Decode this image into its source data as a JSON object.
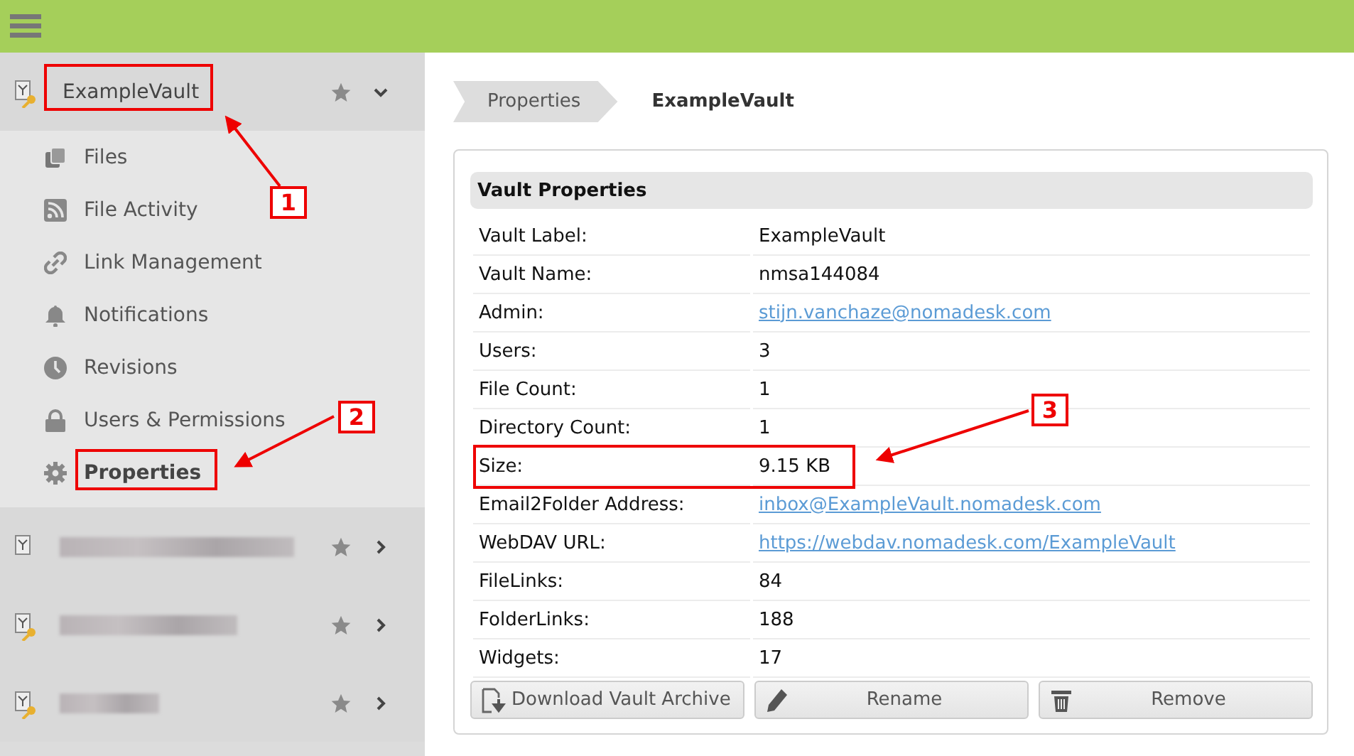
{
  "sidebar": {
    "vault": {
      "name": "ExampleVault",
      "expanded": true,
      "keyed": true
    },
    "items": [
      {
        "label": "Files",
        "kind": "files",
        "selected": false
      },
      {
        "label": "File Activity",
        "kind": "rss",
        "selected": false
      },
      {
        "label": "Link Management",
        "kind": "link",
        "selected": false
      },
      {
        "label": "Notifications",
        "kind": "bell",
        "selected": false
      },
      {
        "label": "Revisions",
        "kind": "clock",
        "selected": false
      },
      {
        "label": "Users & Permissions",
        "kind": "lock",
        "selected": false
      },
      {
        "label": "Properties",
        "kind": "gear",
        "selected": true
      }
    ],
    "other_vaults": [
      {
        "keyed": false,
        "expanded": false
      },
      {
        "keyed": true,
        "expanded": false
      },
      {
        "keyed": true,
        "expanded": false
      }
    ]
  },
  "breadcrumb": [
    {
      "label": "Properties"
    },
    {
      "label": "ExampleVault"
    }
  ],
  "panel": {
    "title": "Vault Properties",
    "rows": [
      {
        "label": "Vault Label:",
        "value": "ExampleVault",
        "kind": "text"
      },
      {
        "label": "Vault Name:",
        "value": "nmsa144084",
        "kind": "text"
      },
      {
        "label": "Admin:",
        "value": "stijn.vanchaze@nomadesk.com",
        "kind": "link"
      },
      {
        "label": "Users:",
        "value": "3",
        "kind": "text"
      },
      {
        "label": "File Count:",
        "value": "1",
        "kind": "text"
      },
      {
        "label": "Directory Count:",
        "value": "1",
        "kind": "text"
      },
      {
        "label": "Size:",
        "value": "9.15 KB",
        "kind": "text"
      },
      {
        "label": "Email2Folder Address:",
        "value": "inbox@ExampleVault.nomadesk.com",
        "kind": "link"
      },
      {
        "label": "WebDAV URL:",
        "value": "https://webdav.nomadesk.com/ExampleVault",
        "kind": "link"
      },
      {
        "label": "FileLinks:",
        "value": "84",
        "kind": "text"
      },
      {
        "label": "FolderLinks:",
        "value": "188",
        "kind": "text"
      },
      {
        "label": "Widgets:",
        "value": "17",
        "kind": "text"
      }
    ],
    "buttons": [
      {
        "label": "Download Vault Archive",
        "kind": "download"
      },
      {
        "label": "Rename",
        "kind": "rename"
      },
      {
        "label": "Remove",
        "kind": "remove"
      }
    ]
  },
  "annotations": [
    {
      "label": "1"
    },
    {
      "label": "2"
    },
    {
      "label": "3"
    }
  ]
}
